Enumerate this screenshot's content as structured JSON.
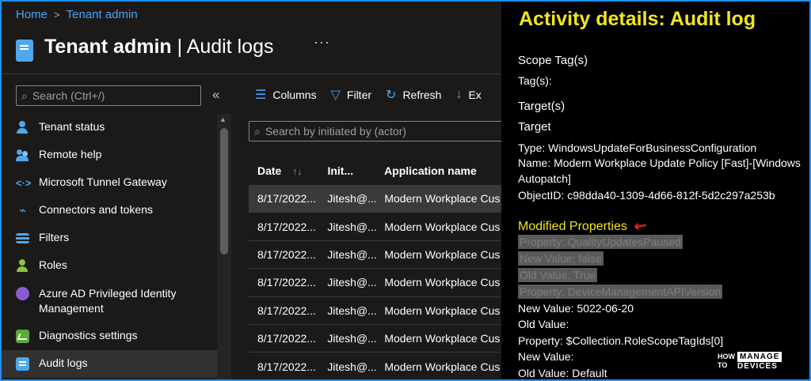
{
  "breadcrumb": {
    "home": "Home",
    "separator": ">",
    "current": "Tenant admin"
  },
  "page": {
    "title_bold": "Tenant admin",
    "title_rest": " | Audit logs",
    "more": "···"
  },
  "sidebar": {
    "search_placeholder": "Search (Ctrl+/)",
    "collapse": "«",
    "items": [
      {
        "label": "Tenant status",
        "icon": "person-icon"
      },
      {
        "label": "Remote help",
        "icon": "people-icon"
      },
      {
        "label": "Microsoft Tunnel Gateway",
        "icon": "tunnel-icon"
      },
      {
        "label": "Connectors and tokens",
        "icon": "plug-icon"
      },
      {
        "label": "Filters",
        "icon": "filter-list-icon"
      },
      {
        "label": "Roles",
        "icon": "roles-icon"
      },
      {
        "label": "Azure AD Privileged Identity Management",
        "icon": "pim-icon"
      },
      {
        "label": "Diagnostics settings",
        "icon": "diagnostics-icon"
      },
      {
        "label": "Audit logs",
        "icon": "audit-logs-icon",
        "active": true
      }
    ]
  },
  "toolbar": {
    "columns": "Columns",
    "filter": "Filter",
    "refresh": "Refresh",
    "export": "Ex"
  },
  "table": {
    "search_placeholder": "Search by initiated by (actor)",
    "headers": {
      "date": "Date",
      "initiated": "Init...",
      "app": "Application name"
    },
    "rows": [
      {
        "date": "8/17/2022...",
        "initiated": "Jitesh@...",
        "app": "Modern Workplace Cus"
      },
      {
        "date": "8/17/2022...",
        "initiated": "Jitesh@...",
        "app": "Modern Workplace Cus"
      },
      {
        "date": "8/17/2022...",
        "initiated": "Jitesh@...",
        "app": "Modern Workplace Cus"
      },
      {
        "date": "8/17/2022...",
        "initiated": "Jitesh@...",
        "app": "Modern Workplace Cus"
      },
      {
        "date": "8/17/2022...",
        "initiated": "Jitesh@...",
        "app": "Modern Workplace Cus"
      },
      {
        "date": "8/17/2022...",
        "initiated": "Jitesh@...",
        "app": "Modern Workplace Cus"
      },
      {
        "date": "8/17/2022...",
        "initiated": "Jitesh@...",
        "app": "Modern Workplace Cus"
      }
    ]
  },
  "details": {
    "title": "Activity details: Audit log",
    "scope_tags": "Scope Tag(s)",
    "tags": "Tag(s):",
    "targets": "Target(s)",
    "target": "Target",
    "type": "Type: WindowsUpdateForBusinessConfiguration",
    "name": "Name: Modern Workplace Update Policy [Fast]-[Windows Autopatch]",
    "object_id": "ObjectID: c98dda40-1309-4d66-812f-5d2c297a253b",
    "modified_properties": "Modified Properties",
    "prop1": "Property: QualityUpdatesPaused",
    "new1": "New Value: false",
    "old1": "Old Value: True",
    "prop2": "Property: DeviceManagementAPIVersion",
    "new2": "New Value: 5022-06-20",
    "old2": "Old Value:",
    "prop3": "Property: $Collection.RoleScopeTagIds[0]",
    "new3": "New Value:",
    "old3": "Old Value: Default"
  },
  "watermark": {
    "how": "HOW",
    "to": "TO",
    "manage": "MANAGE",
    "devices": "DEVICES"
  },
  "colors": {
    "accent": "#4ea1f3",
    "highlight": "#f0e51f",
    "arrow": "#e62020"
  }
}
